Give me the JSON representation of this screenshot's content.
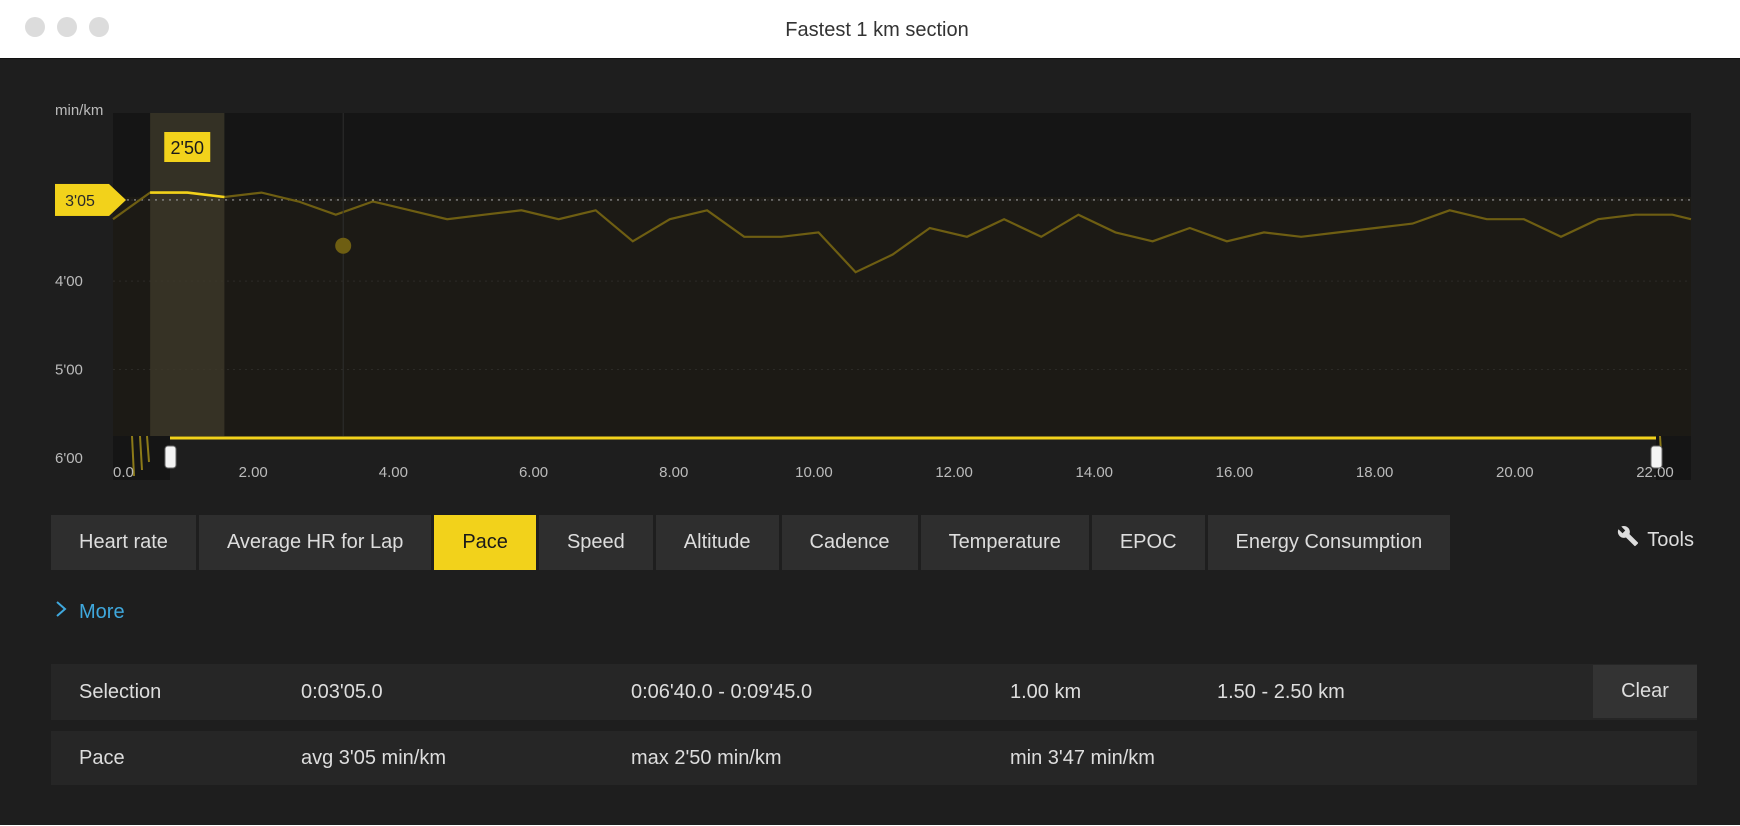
{
  "window": {
    "title": "Fastest 1 km section"
  },
  "chart": {
    "y_unit": "min/km",
    "y_ticks": [
      "4'00",
      "5'00",
      "6'00"
    ],
    "x_ticks": [
      "2.00",
      "4.00",
      "6.00",
      "8.00",
      "10.00",
      "12.00",
      "14.00",
      "16.00",
      "18.00",
      "20.00",
      "22.00"
    ],
    "avg_marker_label": "3'05",
    "max_marker_label": "2'50",
    "accent_color": "#f2d21b"
  },
  "chart_data": {
    "type": "line",
    "ylabel": "min/km",
    "y_inverted": true,
    "xlim": [
      1.0,
      22.25
    ],
    "ylim": [
      6.0,
      2.1
    ],
    "grid": true,
    "avg_line": 3.083,
    "selection_range": [
      1.5,
      2.5
    ],
    "series": [
      {
        "x": [
          1.0,
          1.5,
          2.0,
          2.5,
          3.0,
          3.5,
          4.0,
          4.5,
          5.0,
          5.5,
          6.0,
          6.5,
          7.0,
          7.5,
          8.0,
          8.5,
          9.0,
          9.5,
          10.0,
          10.5,
          11.0,
          11.5,
          12.0,
          12.5,
          13.0,
          13.5,
          14.0,
          14.5,
          15.0,
          15.5,
          16.0,
          16.5,
          17.0,
          17.5,
          18.0,
          18.5,
          19.0,
          19.5,
          20.0,
          20.5,
          21.0,
          21.5,
          22.0,
          22.25
        ],
        "y": [
          3.3,
          3.0,
          3.0,
          3.05,
          3.0,
          3.1,
          3.25,
          3.1,
          3.2,
          3.3,
          3.25,
          3.2,
          3.3,
          3.2,
          3.55,
          3.3,
          3.2,
          3.5,
          3.5,
          3.45,
          3.9,
          3.7,
          3.4,
          3.5,
          3.3,
          3.5,
          3.25,
          3.45,
          3.55,
          3.4,
          3.55,
          3.45,
          3.5,
          3.45,
          3.4,
          3.35,
          3.2,
          3.3,
          3.3,
          3.5,
          3.3,
          3.25,
          3.25,
          3.3
        ]
      }
    ]
  },
  "navigator": {
    "x_ticks": [
      "0.0",
      "2.00",
      "4.00",
      "6.00",
      "8.00",
      "10.00",
      "12.00",
      "14.00",
      "16.00",
      "18.00",
      "20.00",
      "22.00"
    ]
  },
  "tabs": [
    {
      "label": "Heart rate",
      "active": false
    },
    {
      "label": "Average HR for Lap",
      "active": false
    },
    {
      "label": "Pace",
      "active": true
    },
    {
      "label": "Speed",
      "active": false
    },
    {
      "label": "Altitude",
      "active": false
    },
    {
      "label": "Cadence",
      "active": false
    },
    {
      "label": "Temperature",
      "active": false
    },
    {
      "label": "EPOC",
      "active": false
    },
    {
      "label": "Energy Consumption",
      "active": false
    }
  ],
  "tools": {
    "label": "Tools",
    "icon": "wrench-icon"
  },
  "more": {
    "label": "More",
    "icon": "chevron-right-icon"
  },
  "selection_row": {
    "label": "Selection",
    "duration": "0:03'05.0",
    "time_range": "0:06'40.0 - 0:09'45.0",
    "distance": "1.00 km",
    "distance_range": "1.50 - 2.50 km",
    "clear_label": "Clear"
  },
  "pace_row": {
    "label": "Pace",
    "avg": "avg 3'05 min/km",
    "max": "max 2'50 min/km",
    "min": "min 3'47 min/km"
  }
}
